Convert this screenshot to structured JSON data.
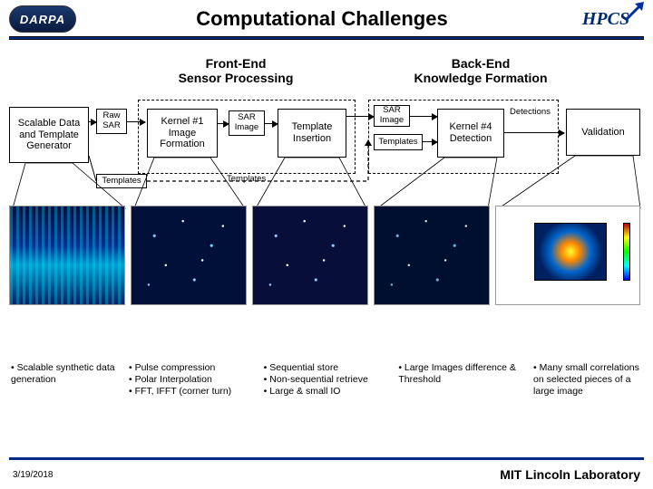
{
  "logos": {
    "darpa": "DARPA",
    "hpcs": "HPCS"
  },
  "title": "Computational Challenges",
  "sections": {
    "front": "Front-End\nSensor Processing",
    "back": "Back-End\nKnowledge Formation"
  },
  "boxes": {
    "generator": "Scalable Data\nand Template\nGenerator",
    "raw_sar": "Raw\nSAR",
    "kernel1": "Kernel #1\nImage\nFormation",
    "sar_image": "SAR\nImage",
    "template_insertion": "Template\nInsertion",
    "sar_image2": "SAR\nImage",
    "templates2": "Templates",
    "kernel4": "Kernel #4\nDetection",
    "detections": "Detections",
    "validation": "Validation",
    "templates1": "Templates",
    "templates_mid": "Templates"
  },
  "bullets": {
    "col1": [
      "• Scalable synthetic data generation"
    ],
    "col2": [
      "• Pulse compression",
      "• Polar Interpolation",
      "• FFT, IFFT (corner turn)"
    ],
    "col3": [
      "• Sequential store",
      "• Non-sequential retrieve",
      "• Large & small IO"
    ],
    "col4": [
      "• Large Images difference & Threshold"
    ],
    "col5": [
      "• Many small correlations on selected pieces of a large image"
    ]
  },
  "footer": {
    "date": "3/19/2018",
    "org": "MIT Lincoln Laboratory"
  }
}
